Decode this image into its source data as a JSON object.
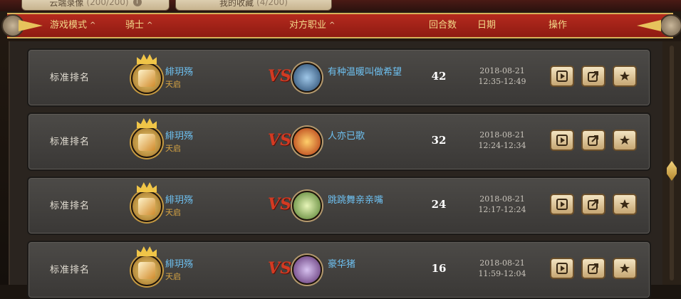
{
  "tabs": [
    {
      "label": "云端录像",
      "count": "(200/200)"
    },
    {
      "label": "我的收藏",
      "count": "(4/200)"
    }
  ],
  "header": {
    "columns": [
      {
        "label": "游戏模式",
        "sort": "^"
      },
      {
        "label": "骑士",
        "sort": "^"
      },
      {
        "label": "对方职业",
        "sort": "^"
      },
      {
        "label": "回合数",
        "sort": ""
      },
      {
        "label": "日期",
        "sort": ""
      },
      {
        "label": "操作",
        "sort": ""
      }
    ]
  },
  "rows": [
    {
      "mode": "标准排名",
      "player": "緋玥殇",
      "rank": "天启",
      "vs": "VS",
      "opponent": "有种温暖叫做希望",
      "rounds": "42",
      "date": "2018-08-21",
      "time": "12:35-12:49",
      "opp_icon": "sword-class-icon"
    },
    {
      "mode": "标准排名",
      "player": "緋玥殇",
      "rank": "天启",
      "vs": "VS",
      "opponent": "人亦已歌",
      "rounds": "32",
      "date": "2018-08-21",
      "time": "12:24-12:34",
      "opp_icon": "fire-class-icon"
    },
    {
      "mode": "标准排名",
      "player": "緋玥殇",
      "rank": "天启",
      "vs": "VS",
      "opponent": "跳跳舞亲亲嘴",
      "rounds": "24",
      "date": "2018-08-21",
      "time": "12:17-12:24",
      "opp_icon": "claw-class-icon"
    },
    {
      "mode": "标准排名",
      "player": "緋玥殇",
      "rank": "天启",
      "vs": "VS",
      "opponent": "豪华猪",
      "rounds": "16",
      "date": "2018-08-21",
      "time": "11:59-12:04",
      "opp_icon": "crowned-rogue-class-icon"
    }
  ],
  "colors": {
    "accent_red": "#9e2216",
    "gold": "#e7c35c",
    "name_blue": "#6ec0f0",
    "rank_gold": "#d6a343"
  }
}
